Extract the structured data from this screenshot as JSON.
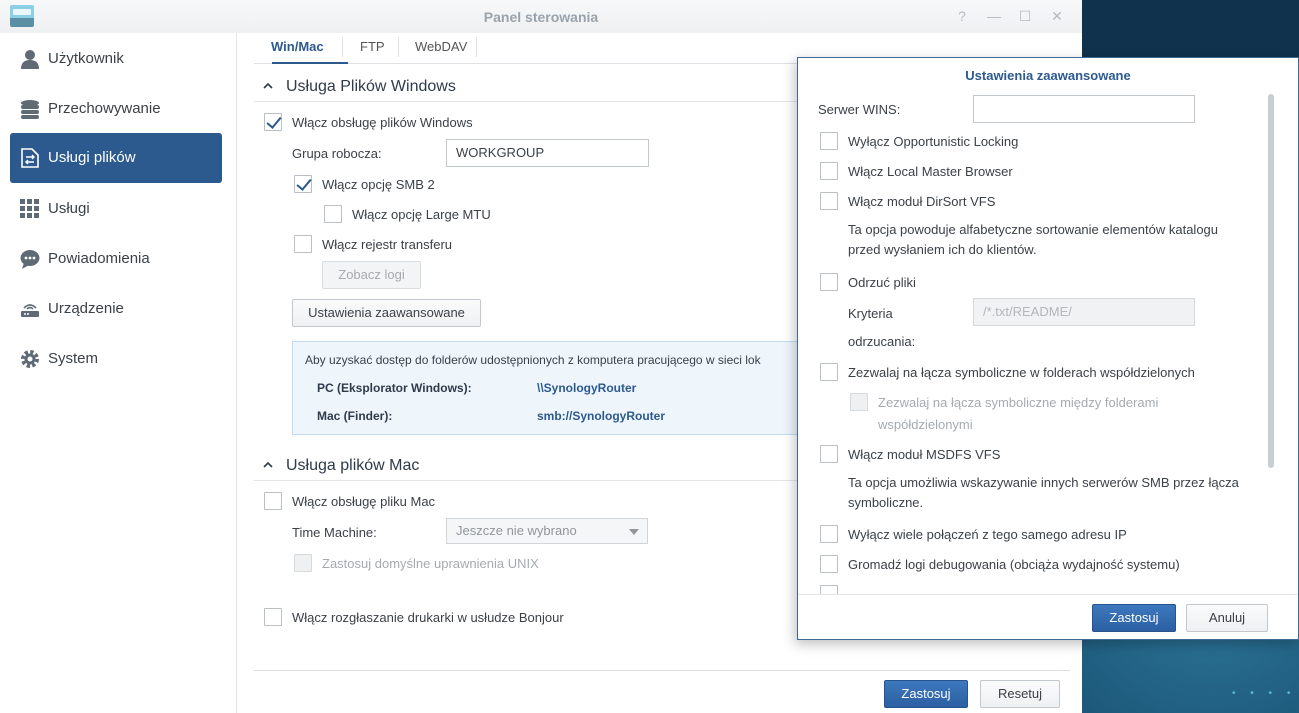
{
  "window": {
    "title": "Panel sterowania",
    "controls": {
      "help": "?",
      "minimize": "—",
      "maximize": "☐",
      "close": "✕"
    }
  },
  "sidebar": {
    "items": [
      {
        "label": "Użytkownik",
        "icon": "user-icon"
      },
      {
        "label": "Przechowywanie",
        "icon": "storage-icon"
      },
      {
        "label": "Usługi plików",
        "icon": "file-services-icon",
        "active": true
      },
      {
        "label": "Usługi",
        "icon": "services-grid-icon"
      },
      {
        "label": "Powiadomienia",
        "icon": "chat-bubble-icon"
      },
      {
        "label": "Urządzenie",
        "icon": "router-icon"
      },
      {
        "label": "System",
        "icon": "gear-icon"
      }
    ]
  },
  "tabs": [
    {
      "label": "Win/Mac",
      "active": true
    },
    {
      "label": "FTP"
    },
    {
      "label": "WebDAV"
    }
  ],
  "windows_section": {
    "title": "Usługa Plików Windows",
    "enable_label": "Włącz obsługę plików Windows",
    "enable_checked": true,
    "workgroup_label": "Grupa robocza:",
    "workgroup_value": "WORKGROUP",
    "smb2_label": "Włącz opcję SMB 2",
    "smb2_checked": true,
    "large_mtu_label": "Włącz opcję Large MTU",
    "large_mtu_checked": false,
    "transfer_log_label": "Włącz rejestr transferu",
    "transfer_log_checked": false,
    "view_logs_button": "Zobacz logi",
    "advanced_button": "Ustawienia zaawansowane",
    "info": {
      "text": "Aby uzyskać dostęp do folderów udostępnionych z komputera pracującego w sieci lok",
      "pc_label": "PC (Eksplorator Windows):",
      "pc_value": "\\\\SynologyRouter",
      "mac_label": "Mac (Finder):",
      "mac_value": "smb://SynologyRouter"
    }
  },
  "mac_section": {
    "title": "Usługa plików Mac",
    "enable_label": "Włącz obsługę pliku Mac",
    "enable_checked": false,
    "time_machine_label": "Time Machine:",
    "time_machine_value": "Jeszcze nie wybrano",
    "unix_perm_label": "Zastosuj domyślne uprawnienia UNIX"
  },
  "bonjour_label": "Włącz rozgłaszanie drukarki w usłudze Bonjour",
  "footer": {
    "apply": "Zastosuj",
    "reset": "Resetuj"
  },
  "dialog": {
    "title": "Ustawienia zaawansowane",
    "wins_label": "Serwer WINS:",
    "wins_value": "",
    "opp_locking": "Wyłącz Opportunistic Locking",
    "local_master": "Włącz Local Master Browser",
    "dirsort": "Włącz moduł DirSort VFS",
    "dirsort_desc_1": "Ta opcja powoduje alfabetyczne sortowanie elementów katalogu",
    "dirsort_desc_2": "przed wysłaniem ich do klientów.",
    "veto": "Odrzuć pliki",
    "veto_criteria_label_1": "Kryteria",
    "veto_criteria_label_2": "odrzucania:",
    "veto_placeholder": "/*.txt/README/",
    "symlinks": "Zezwalaj na łącza symboliczne w folderach współdzielonych",
    "symlinks_between_1": "Zezwalaj na łącza symboliczne między folderami",
    "symlinks_between_2": "współdzielonymi",
    "msdfs": "Włącz moduł MSDFS VFS",
    "msdfs_desc_1": "Ta opcja umożliwia wskazywanie innych serwerów SMB przez łącza",
    "msdfs_desc_2": "symboliczne.",
    "multi_conn": "Wyłącz wiele połączeń z tego samego adresu IP",
    "debug_logs": "Gromadź logi debugowania (obciąża wydajność systemu)",
    "apply": "Zastosuj",
    "cancel": "Anuluj"
  }
}
